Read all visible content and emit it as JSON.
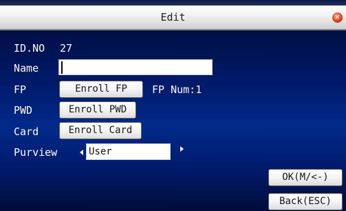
{
  "window": {
    "title": "Edit"
  },
  "form": {
    "id_label": "ID.NO",
    "id_value": "27",
    "name_label": "Name",
    "name_value": "",
    "fp_label": "FP",
    "fp_button": "Enroll FP",
    "fp_num": "FP Num:1",
    "pwd_label": "PWD",
    "pwd_button": "Enroll PWD",
    "card_label": "Card",
    "card_button": "Enroll Card",
    "purview_label": "Purview",
    "purview_value": "User"
  },
  "actions": {
    "ok": "OK(M/<-)",
    "back": "Back(ESC)"
  },
  "colors": {
    "background": "#001a6b",
    "text": "#ffffff",
    "close": "#e8401a"
  },
  "icons": {
    "close": "close-icon",
    "prev": "arrow-left-icon",
    "next": "arrow-right-icon"
  }
}
